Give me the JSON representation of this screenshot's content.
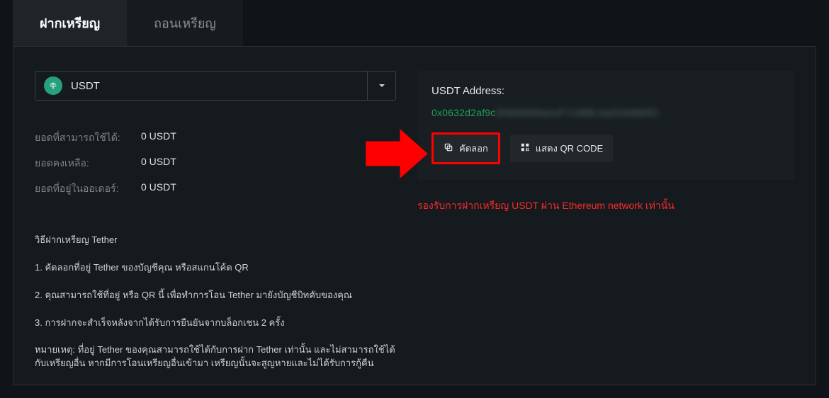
{
  "tabs": {
    "deposit": "ฝากเหรียญ",
    "withdraw": "ถอนเหรียญ"
  },
  "currency": {
    "symbol": "USDT",
    "icon": "tether-icon"
  },
  "balances": {
    "available_label": "ยอดที่สามารถใช้ได้:",
    "available_value": "0 USDT",
    "remaining_label": "ยอดคงเหลือ:",
    "remaining_value": "0 USDT",
    "in_order_label": "ยอดที่อยู่ในออเดอร์:",
    "in_order_value": "0 USDT"
  },
  "instructions": {
    "title": "วิธีฝากเหรียญ Tether",
    "step1": "1. คัดลอกที่อยู่ Tether ของบัญชีคุณ หรือสแกนโค้ด QR",
    "step2": "2. คุณสามารถใช้ที่อยู่ หรือ QR นี้ เพื่อทำการโอน Tether มายังบัญชีบิทคับของคุณ",
    "step3": "3. การฝากจะสำเร็จหลังจากได้รับการยืนยันจากบล็อกเชน 2 ครั้ง",
    "note": "หมายเหตุ: ที่อยู่ Tether ของคุณสามารถใช้ได้กับการฝาก Tether เท่านั้น และไม่สามารถใช้ได้กับเหรียญอื่น หากมีการโอนเหรียญอื่นเข้ามา เหรียญนั้นจะสูญหายและไม่ได้รับการกู้คืน"
  },
  "address_card": {
    "label": "USDT Address:",
    "value_visible": "0x0632d2af9c",
    "value_hidden": "654b9449aAcF7146fb baA5446bf51",
    "copy_label": "คัดลอก",
    "qr_label": "แสดง QR CODE"
  },
  "warning_text": "รองรับการฝากเหรียญ USDT ผ่าน Ethereum network เท่านั้น"
}
